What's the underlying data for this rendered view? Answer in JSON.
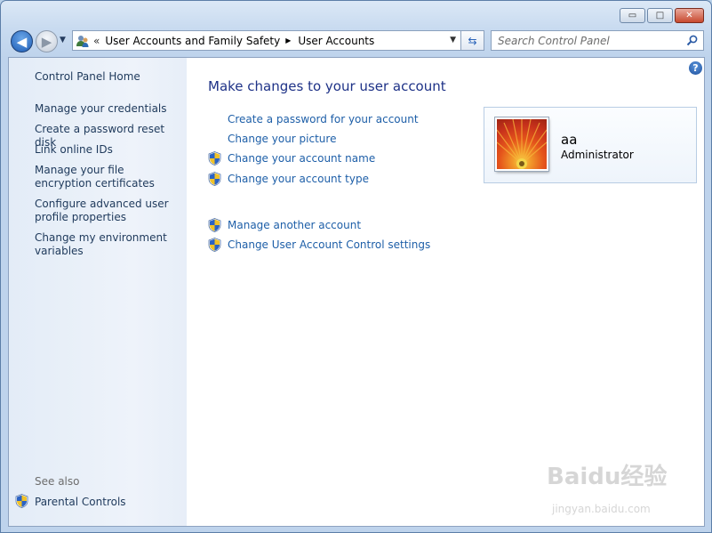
{
  "window": {
    "minimize": "▭",
    "maximize": "□",
    "close": "✕"
  },
  "address": {
    "overflow": "«",
    "crumbs": [
      "User Accounts and Family Safety",
      "User Accounts"
    ],
    "search_placeholder": "Search Control Panel"
  },
  "sidebar": {
    "home": "Control Panel Home",
    "links": [
      "Manage your credentials",
      "Create a password reset disk",
      "Link online IDs",
      "Manage your file encryption certificates",
      "Configure advanced user profile properties",
      "Change my environment variables"
    ],
    "see_also": "See also",
    "parental": "Parental Controls"
  },
  "main": {
    "title": "Make changes to your user account",
    "links": [
      "Create a password for your account",
      "Change your picture",
      "Change your account name",
      "Change your account type",
      "Manage another account",
      "Change User Account Control settings"
    ]
  },
  "account": {
    "name": "aa",
    "type": "Administrator"
  },
  "watermark": {
    "logo": "Baidu经验",
    "url": "jingyan.baidu.com"
  }
}
